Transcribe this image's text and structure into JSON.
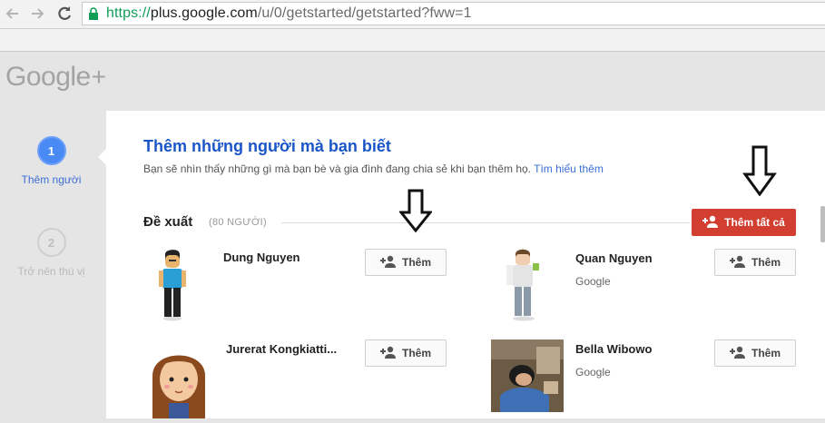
{
  "browser": {
    "url_protocol": "https://",
    "url_host": "plus.google.com",
    "url_path": "/u/0/getstarted/getstarted?fww=1"
  },
  "header": {
    "logo_text": "Google",
    "logo_plus": "+"
  },
  "steps": [
    {
      "number": "1",
      "label": "Thêm người"
    },
    {
      "number": "2",
      "label": "Trở nên thú vị"
    }
  ],
  "main": {
    "title": "Thêm những người mà bạn biết",
    "subtitle": "Bạn sẽ nhìn thấy những gì mà bạn bè và gia đình đang chia sẻ khi bạn thêm họ.",
    "learn_more": "Tìm hiểu thêm",
    "section_title": "Đề xuất",
    "section_count": "(80 NGƯỜI)",
    "add_all_label": "Thêm tất cả"
  },
  "people": [
    {
      "name": "Dung Nguyen",
      "sub": "",
      "add_label": "Thêm"
    },
    {
      "name": "Quan Nguyen",
      "sub": "Google",
      "add_label": "Thêm"
    },
    {
      "name": "Jurerat Kongkiatti...",
      "sub": "",
      "add_label": "Thêm"
    },
    {
      "name": "Bella Wibowo",
      "sub": "Google",
      "add_label": "Thêm"
    }
  ],
  "colors": {
    "accent_blue": "#1a56c8",
    "step_active": "#4a8af4",
    "add_all_red": "#d23f31",
    "https_green": "#0f9d58"
  },
  "icons": [
    "back-arrow-icon",
    "forward-arrow-icon",
    "reload-icon",
    "lock-icon",
    "add-person-icon",
    "down-arrow-annotation-icon"
  ]
}
